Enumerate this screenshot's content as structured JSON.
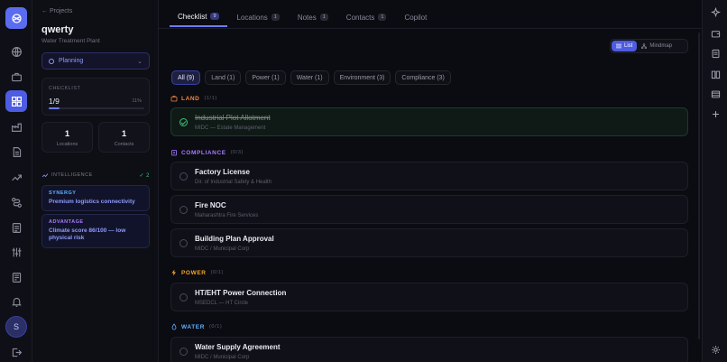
{
  "panel": {
    "back_label": "← Projects",
    "project_name": "qwerty",
    "project_type": "Water Treatment Plant",
    "status": "Planning",
    "checklist": {
      "label": "CHECKLIST",
      "value": "1/9",
      "percent_label": "11%",
      "progress": 0.11
    },
    "stats": [
      {
        "value": "1",
        "label": "Locations"
      },
      {
        "value": "1",
        "label": "Contacts"
      }
    ],
    "intelligence": {
      "label": "INTELLIGENCE",
      "count": "✓ 2",
      "insights": [
        {
          "kind": "SYNERGY",
          "text": "Premium logistics connectivity",
          "color": "#5fb0ff"
        },
        {
          "kind": "ADVANTAGE",
          "text": "Climate score 86/100 — low physical risk",
          "color": "#a77bff"
        }
      ]
    }
  },
  "tabs": [
    {
      "label": "Checklist",
      "count": "9"
    },
    {
      "label": "Locations",
      "count": "1"
    },
    {
      "label": "Notes",
      "count": "1"
    },
    {
      "label": "Contacts",
      "count": "1"
    },
    {
      "label": "Copilot",
      "count": ""
    }
  ],
  "view_toggle": {
    "list": "List",
    "mindmap": "Mindmap"
  },
  "filters": [
    "All (9)",
    "Land (1)",
    "Power (1)",
    "Water (1)",
    "Environment (3)",
    "Compliance (3)"
  ],
  "sections": {
    "land": {
      "title": "LAND",
      "frac": "(1/1)",
      "color": "#f0883e"
    },
    "compliance": {
      "title": "COMPLIANCE",
      "frac": "(0/3)",
      "color": "#a77bff"
    },
    "power": {
      "title": "POWER",
      "frac": "(0/1)",
      "color": "#f5a623"
    },
    "water": {
      "title": "WATER",
      "frac": "(0/1)",
      "color": "#5fb0ff"
    }
  },
  "items": [
    {
      "title": "Industrial Plot Allotment",
      "sub": "MIDC — Estate Management"
    },
    {
      "title": "Factory License",
      "sub": "Dir. of Industrial Safety & Health"
    },
    {
      "title": "Fire NOC",
      "sub": "Maharashtra Fire Services"
    },
    {
      "title": "Building Plan Approval",
      "sub": "MIDC / Municipal Corp"
    },
    {
      "title": "HT/EHT Power Connection",
      "sub": "MSEDCL — HT Circle"
    },
    {
      "title": "Water Supply Agreement",
      "sub": "MIDC / Municipal Corp"
    }
  ],
  "rail": {
    "avatar": "S"
  }
}
